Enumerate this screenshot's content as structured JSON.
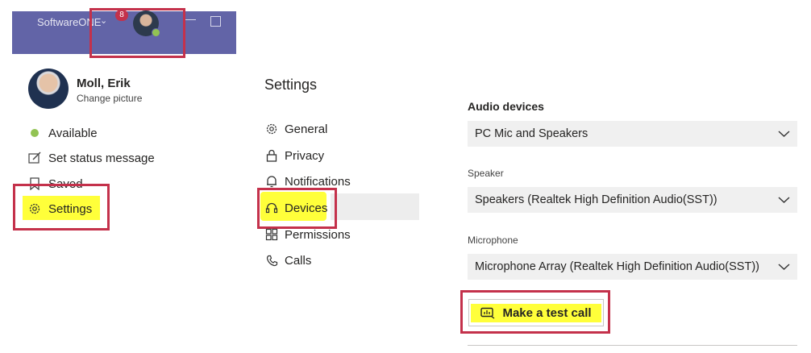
{
  "titlebar": {
    "org_name": "SoftwareONE",
    "notification_count": "8"
  },
  "profile": {
    "name": "Moll, Erik",
    "change_picture": "Change picture"
  },
  "menu": {
    "available": "Available",
    "set_status": "Set status message",
    "saved": "Saved",
    "settings": "Settings"
  },
  "settings_nav": {
    "title": "Settings",
    "items": [
      "General",
      "Privacy",
      "Notifications",
      "Devices",
      "Permissions",
      "Calls"
    ],
    "selected": "Devices"
  },
  "devices": {
    "audio_title": "Audio devices",
    "audio_value": "PC Mic and Speakers",
    "speaker_label": "Speaker",
    "speaker_value": "Speakers (Realtek High Definition Audio(SST))",
    "mic_label": "Microphone",
    "mic_value": "Microphone Array (Realtek High Definition Audio(SST))",
    "test_call": "Make a test call"
  },
  "colors": {
    "titlebar": "#6264a7",
    "highlight": "#ffff3a",
    "annotation": "#c4314b",
    "presence": "#92c353"
  }
}
